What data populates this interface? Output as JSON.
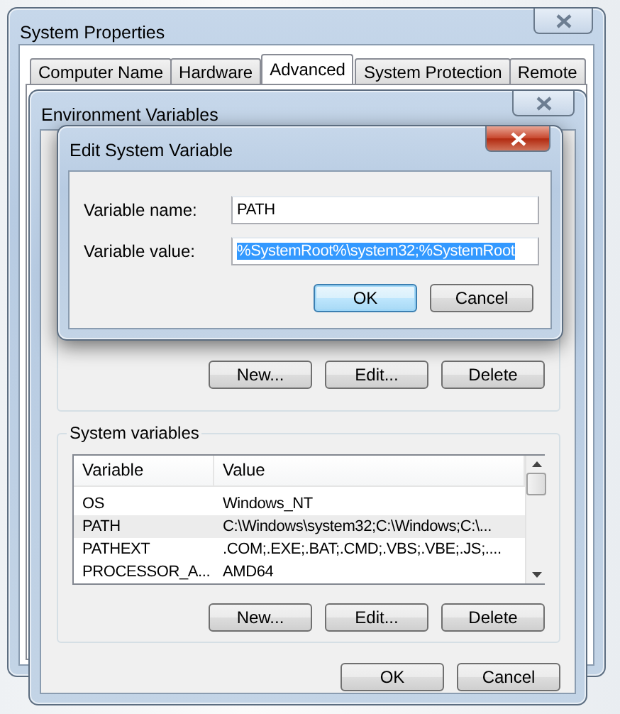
{
  "system_properties": {
    "title": "System Properties",
    "tabs": [
      {
        "label": "Computer Name",
        "selected": false
      },
      {
        "label": "Hardware",
        "selected": false
      },
      {
        "label": "Advanced",
        "selected": true
      },
      {
        "label": "System Protection",
        "selected": false
      },
      {
        "label": "Remote",
        "selected": false
      }
    ]
  },
  "environment_variables": {
    "title": "Environment Variables",
    "user_buttons": [
      "New...",
      "Edit...",
      "Delete"
    ],
    "system_variables": {
      "label": "System variables",
      "columns": [
        "Variable",
        "Value"
      ],
      "rows": [
        {
          "variable": "OS",
          "value": "Windows_NT",
          "selected": false
        },
        {
          "variable": "PATH",
          "value": "C:\\Windows\\system32;C:\\Windows;C:\\...",
          "selected": true
        },
        {
          "variable": "PATHEXT",
          "value": ".COM;.EXE;.BAT;.CMD;.VBS;.VBE;.JS;....",
          "selected": false
        },
        {
          "variable": "PROCESSOR_A...",
          "value": "AMD64",
          "selected": false
        }
      ]
    },
    "system_buttons": [
      "New...",
      "Edit...",
      "Delete"
    ],
    "dialog_buttons": [
      {
        "label": "OK",
        "default": false
      },
      {
        "label": "Cancel",
        "default": false
      }
    ]
  },
  "edit_system_variable": {
    "title": "Edit System Variable",
    "fields": [
      {
        "label": "Variable name:",
        "value": "PATH",
        "text_selected": false
      },
      {
        "label": "Variable value:",
        "value": "%SystemRoot%\\system32;%SystemRoot",
        "text_selected": true
      }
    ],
    "buttons": [
      {
        "label": "OK",
        "default": true
      },
      {
        "label": "Cancel",
        "default": false
      }
    ]
  }
}
